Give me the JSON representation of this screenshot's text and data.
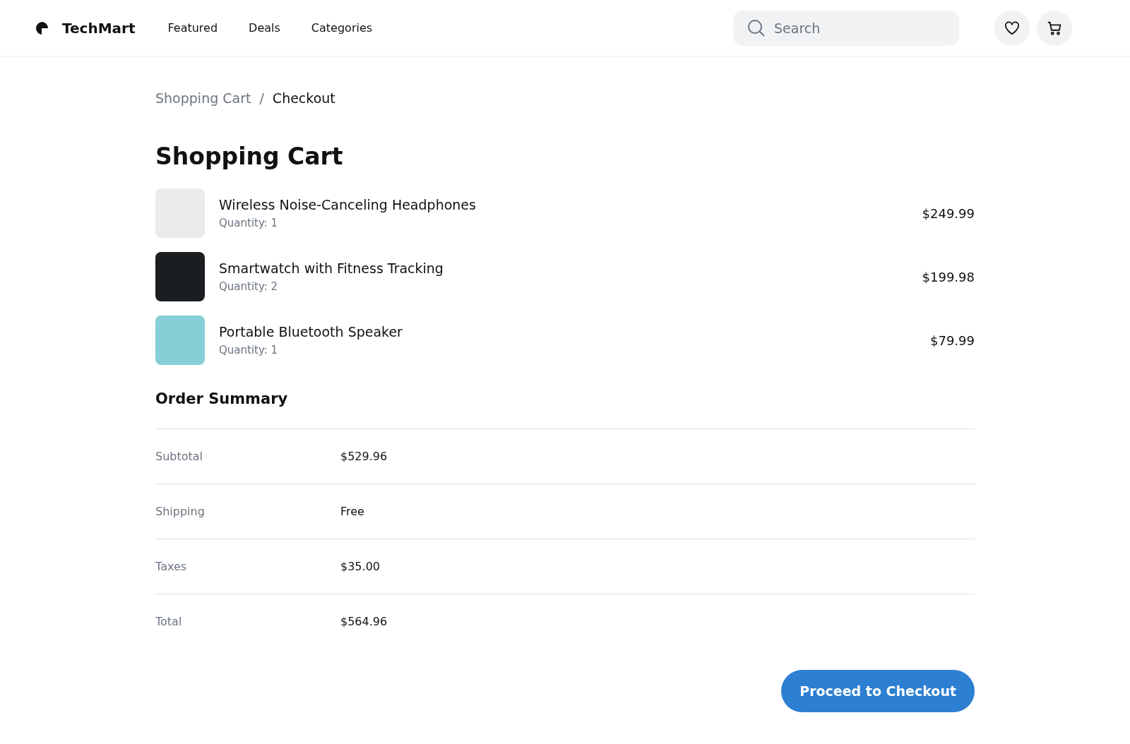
{
  "header": {
    "brand": "TechMart",
    "nav": [
      {
        "label": "Featured"
      },
      {
        "label": "Deals"
      },
      {
        "label": "Categories"
      }
    ],
    "search": {
      "placeholder": "Search"
    }
  },
  "breadcrumb": {
    "separator": "/",
    "items": [
      "Shopping Cart",
      "Checkout"
    ]
  },
  "title": "Shopping Cart",
  "items": [
    {
      "name": "Wireless Noise-Canceling Headphones",
      "quantity": "Quantity: 1",
      "price": "$249.99"
    },
    {
      "name": "Smartwatch with Fitness Tracking",
      "quantity": "Quantity: 2",
      "price": "$199.98"
    },
    {
      "name": "Portable Bluetooth Speaker",
      "quantity": "Quantity: 1",
      "price": "$79.99"
    }
  ],
  "summary": {
    "title": "Order Summary",
    "rows": [
      {
        "label": "Subtotal",
        "value": "$529.96"
      },
      {
        "label": "Shipping",
        "value": "Free"
      },
      {
        "label": "Taxes",
        "value": "$35.00"
      },
      {
        "label": "Total",
        "value": "$564.96"
      }
    ]
  },
  "checkout_button": "Proceed to Checkout"
}
